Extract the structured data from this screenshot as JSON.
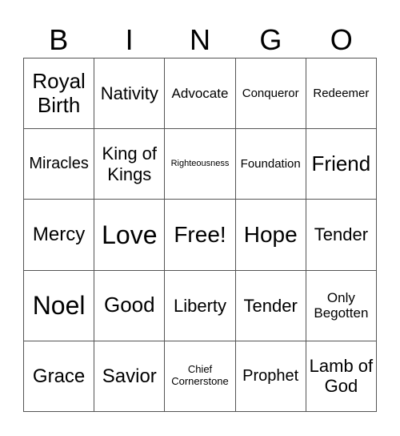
{
  "header": {
    "letters": [
      "B",
      "I",
      "N",
      "G",
      "O"
    ]
  },
  "board": {
    "rows": [
      [
        "Royal Birth",
        "Nativity",
        "Advocate",
        "Conqueror",
        "Redeemer"
      ],
      [
        "Miracles",
        "King of Kings",
        "Righteousness",
        "Foundation",
        "Friend"
      ],
      [
        "Mercy",
        "Love",
        "Free!",
        "Hope",
        "Tender"
      ],
      [
        "Noel",
        "Good",
        "Liberty",
        "Tender",
        "Only Begotten"
      ],
      [
        "Grace",
        "Savior",
        "Chief Cornerstone",
        "Prophet",
        "Lamb of God"
      ]
    ]
  }
}
